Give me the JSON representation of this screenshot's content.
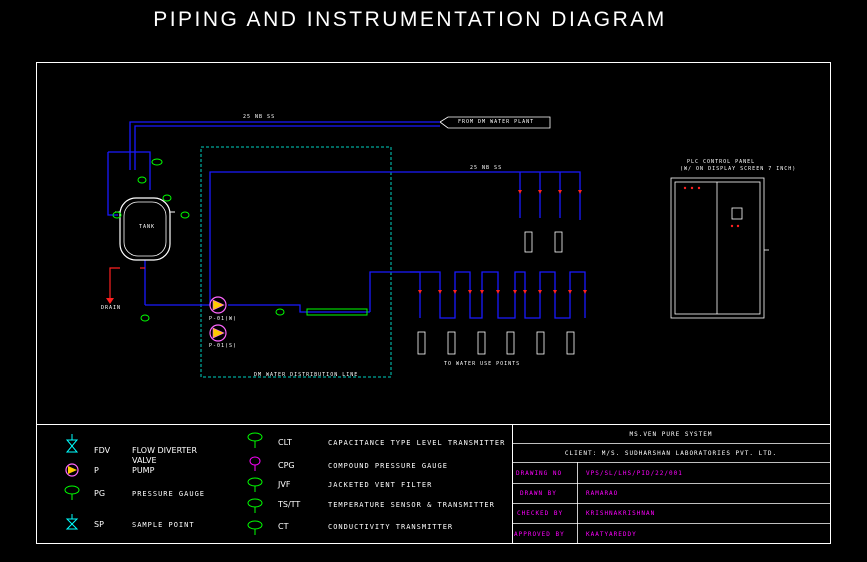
{
  "title": "PIPING AND INSTRUMENTATION DIAGRAM",
  "colors": {
    "background": "#000000",
    "frame": "#ffffff",
    "pipe": "#1a1aff",
    "instrument": "#00ff00",
    "valve": "#ff2020",
    "loop_boundary": "#00d0c0",
    "titleblock_label": "#ff00ff"
  },
  "diagram": {
    "source_label": "FROM DM WATER PLANT",
    "tank_label": "TANK",
    "drain_label": "DRAIN",
    "pump_label_1": "P-01(W)",
    "pump_label_2": "P-01(S)",
    "loop_box_label": "DM WATER DISTRIBUTION LINE",
    "use_points_label": "TO WATER USE POINTS",
    "pipe_size_top": "25 NB SS",
    "pipe_size_mid": "25 NB SS",
    "control_panel_title": "PLC CONTROL PANEL",
    "control_panel_subtitle": "(W/ ON DISPLAY SCREEN 7 INCH)"
  },
  "legend": {
    "left": [
      {
        "code": "FDV",
        "desc": "FLOW DIVERTER VALVE",
        "icon": "flow-diverter-valve-icon"
      },
      {
        "code": "P",
        "desc": "PUMP",
        "icon": "pump-icon"
      },
      {
        "code": "PG",
        "desc": "PRESSURE GAUGE",
        "icon": "pressure-gauge-icon"
      },
      {
        "code": "SP",
        "desc": "SAMPLE POINT",
        "icon": "sample-point-icon"
      }
    ],
    "right": [
      {
        "code": "CLT",
        "desc": "CAPACITANCE TYPE LEVEL TRANSMITTER",
        "icon": "level-transmitter-icon"
      },
      {
        "code": "CPG",
        "desc": "COMPOUND PRESSURE GAUGE",
        "icon": "compound-gauge-icon"
      },
      {
        "code": "JVF",
        "desc": "JACKETED VENT FILTER",
        "icon": "vent-filter-icon"
      },
      {
        "code": "TS/TT",
        "desc": "TEMPERATURE SENSOR & TRANSMITTER",
        "icon": "temperature-transmitter-icon"
      },
      {
        "code": "CT",
        "desc": "CONDUCTIVITY TRANSMITTER",
        "icon": "conductivity-transmitter-icon"
      }
    ]
  },
  "title_block": {
    "system": "MS.VEN PURE SYSTEM",
    "client": "CLIENT: M/S. SUDHARSHAN LABORATORIES PVT. LTD.",
    "rows": [
      {
        "label": "DRAWING NO",
        "value": "VPS/SL/LHS/PID/22/001"
      },
      {
        "label": "DRAWN BY",
        "value": "RAMARAO"
      },
      {
        "label": "CHECKED BY",
        "value": "KRISHNAKRISHNAN"
      },
      {
        "label": "APPROVED BY",
        "value": "KAATYAREDDY"
      }
    ]
  }
}
